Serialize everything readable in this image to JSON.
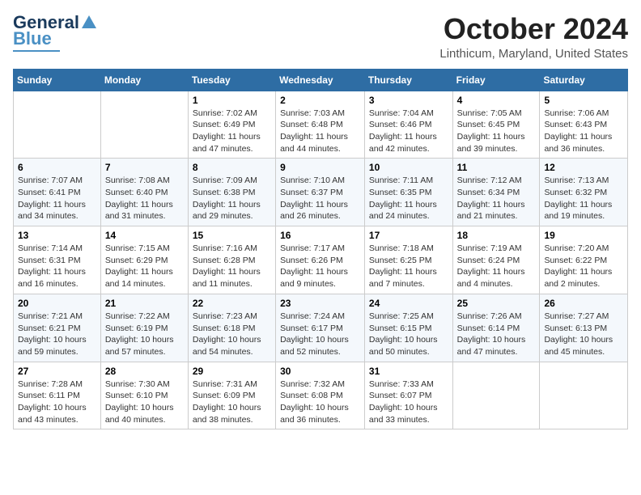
{
  "logo": {
    "line1": "General",
    "line2": "Blue"
  },
  "title": "October 2024",
  "location": "Linthicum, Maryland, United States",
  "weekdays": [
    "Sunday",
    "Monday",
    "Tuesday",
    "Wednesday",
    "Thursday",
    "Friday",
    "Saturday"
  ],
  "weeks": [
    [
      {
        "day": "",
        "info": ""
      },
      {
        "day": "",
        "info": ""
      },
      {
        "day": "1",
        "info": "Sunrise: 7:02 AM\nSunset: 6:49 PM\nDaylight: 11 hours and 47 minutes."
      },
      {
        "day": "2",
        "info": "Sunrise: 7:03 AM\nSunset: 6:48 PM\nDaylight: 11 hours and 44 minutes."
      },
      {
        "day": "3",
        "info": "Sunrise: 7:04 AM\nSunset: 6:46 PM\nDaylight: 11 hours and 42 minutes."
      },
      {
        "day": "4",
        "info": "Sunrise: 7:05 AM\nSunset: 6:45 PM\nDaylight: 11 hours and 39 minutes."
      },
      {
        "day": "5",
        "info": "Sunrise: 7:06 AM\nSunset: 6:43 PM\nDaylight: 11 hours and 36 minutes."
      }
    ],
    [
      {
        "day": "6",
        "info": "Sunrise: 7:07 AM\nSunset: 6:41 PM\nDaylight: 11 hours and 34 minutes."
      },
      {
        "day": "7",
        "info": "Sunrise: 7:08 AM\nSunset: 6:40 PM\nDaylight: 11 hours and 31 minutes."
      },
      {
        "day": "8",
        "info": "Sunrise: 7:09 AM\nSunset: 6:38 PM\nDaylight: 11 hours and 29 minutes."
      },
      {
        "day": "9",
        "info": "Sunrise: 7:10 AM\nSunset: 6:37 PM\nDaylight: 11 hours and 26 minutes."
      },
      {
        "day": "10",
        "info": "Sunrise: 7:11 AM\nSunset: 6:35 PM\nDaylight: 11 hours and 24 minutes."
      },
      {
        "day": "11",
        "info": "Sunrise: 7:12 AM\nSunset: 6:34 PM\nDaylight: 11 hours and 21 minutes."
      },
      {
        "day": "12",
        "info": "Sunrise: 7:13 AM\nSunset: 6:32 PM\nDaylight: 11 hours and 19 minutes."
      }
    ],
    [
      {
        "day": "13",
        "info": "Sunrise: 7:14 AM\nSunset: 6:31 PM\nDaylight: 11 hours and 16 minutes."
      },
      {
        "day": "14",
        "info": "Sunrise: 7:15 AM\nSunset: 6:29 PM\nDaylight: 11 hours and 14 minutes."
      },
      {
        "day": "15",
        "info": "Sunrise: 7:16 AM\nSunset: 6:28 PM\nDaylight: 11 hours and 11 minutes."
      },
      {
        "day": "16",
        "info": "Sunrise: 7:17 AM\nSunset: 6:26 PM\nDaylight: 11 hours and 9 minutes."
      },
      {
        "day": "17",
        "info": "Sunrise: 7:18 AM\nSunset: 6:25 PM\nDaylight: 11 hours and 7 minutes."
      },
      {
        "day": "18",
        "info": "Sunrise: 7:19 AM\nSunset: 6:24 PM\nDaylight: 11 hours and 4 minutes."
      },
      {
        "day": "19",
        "info": "Sunrise: 7:20 AM\nSunset: 6:22 PM\nDaylight: 11 hours and 2 minutes."
      }
    ],
    [
      {
        "day": "20",
        "info": "Sunrise: 7:21 AM\nSunset: 6:21 PM\nDaylight: 10 hours and 59 minutes."
      },
      {
        "day": "21",
        "info": "Sunrise: 7:22 AM\nSunset: 6:19 PM\nDaylight: 10 hours and 57 minutes."
      },
      {
        "day": "22",
        "info": "Sunrise: 7:23 AM\nSunset: 6:18 PM\nDaylight: 10 hours and 54 minutes."
      },
      {
        "day": "23",
        "info": "Sunrise: 7:24 AM\nSunset: 6:17 PM\nDaylight: 10 hours and 52 minutes."
      },
      {
        "day": "24",
        "info": "Sunrise: 7:25 AM\nSunset: 6:15 PM\nDaylight: 10 hours and 50 minutes."
      },
      {
        "day": "25",
        "info": "Sunrise: 7:26 AM\nSunset: 6:14 PM\nDaylight: 10 hours and 47 minutes."
      },
      {
        "day": "26",
        "info": "Sunrise: 7:27 AM\nSunset: 6:13 PM\nDaylight: 10 hours and 45 minutes."
      }
    ],
    [
      {
        "day": "27",
        "info": "Sunrise: 7:28 AM\nSunset: 6:11 PM\nDaylight: 10 hours and 43 minutes."
      },
      {
        "day": "28",
        "info": "Sunrise: 7:30 AM\nSunset: 6:10 PM\nDaylight: 10 hours and 40 minutes."
      },
      {
        "day": "29",
        "info": "Sunrise: 7:31 AM\nSunset: 6:09 PM\nDaylight: 10 hours and 38 minutes."
      },
      {
        "day": "30",
        "info": "Sunrise: 7:32 AM\nSunset: 6:08 PM\nDaylight: 10 hours and 36 minutes."
      },
      {
        "day": "31",
        "info": "Sunrise: 7:33 AM\nSunset: 6:07 PM\nDaylight: 10 hours and 33 minutes."
      },
      {
        "day": "",
        "info": ""
      },
      {
        "day": "",
        "info": ""
      }
    ]
  ]
}
